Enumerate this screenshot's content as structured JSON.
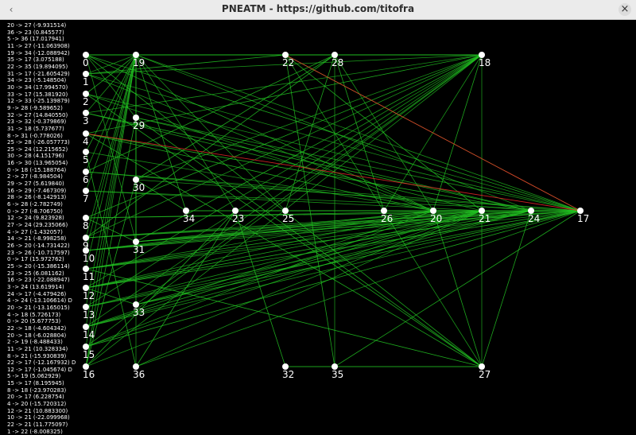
{
  "window": {
    "title": "PNEATM - https://github.com/titofra",
    "close_glyph": "×",
    "left_glyph": "‹"
  },
  "network": {
    "edge_color": "#22c322",
    "negative_edge_color": "#ff2a2a",
    "node_color": "#ffffff",
    "nodes": [
      {
        "id": "0",
        "label": "0"
      },
      {
        "id": "1",
        "label": "1"
      },
      {
        "id": "2",
        "label": "2"
      },
      {
        "id": "3",
        "label": "3"
      },
      {
        "id": "4",
        "label": "4"
      },
      {
        "id": "5",
        "label": "5"
      },
      {
        "id": "6",
        "label": "6"
      },
      {
        "id": "7",
        "label": "7"
      },
      {
        "id": "8",
        "label": "8"
      },
      {
        "id": "9",
        "label": "9"
      },
      {
        "id": "10",
        "label": "10"
      },
      {
        "id": "11",
        "label": "11"
      },
      {
        "id": "12",
        "label": "12"
      },
      {
        "id": "13",
        "label": "13"
      },
      {
        "id": "14",
        "label": "14"
      },
      {
        "id": "15",
        "label": "15"
      },
      {
        "id": "16",
        "label": "16"
      },
      {
        "id": "19",
        "label": "19"
      },
      {
        "id": "29",
        "label": "29"
      },
      {
        "id": "30",
        "label": "30"
      },
      {
        "id": "31",
        "label": "31"
      },
      {
        "id": "33",
        "label": "33"
      },
      {
        "id": "36",
        "label": "36"
      },
      {
        "id": "22",
        "label": "22"
      },
      {
        "id": "28",
        "label": "28"
      },
      {
        "id": "18",
        "label": "18"
      },
      {
        "id": "34",
        "label": "34"
      },
      {
        "id": "23",
        "label": "23"
      },
      {
        "id": "25",
        "label": "25"
      },
      {
        "id": "26",
        "label": "26"
      },
      {
        "id": "20",
        "label": "20"
      },
      {
        "id": "21",
        "label": "21"
      },
      {
        "id": "24",
        "label": "24"
      },
      {
        "id": "17",
        "label": "17"
      },
      {
        "id": "32",
        "label": "32"
      },
      {
        "id": "35",
        "label": "35"
      },
      {
        "id": "27",
        "label": "27"
      }
    ],
    "connections": [
      {
        "text": "20 -> 27  (-9.931514)",
        "from": "20",
        "to": "27",
        "weight": -9.931514
      },
      {
        "text": "36 -> 23  (0.845577)",
        "from": "36",
        "to": "23",
        "weight": 0.845577
      },
      {
        "text": "5 -> 36  (17.017941)",
        "from": "5",
        "to": "36",
        "weight": 17.017941
      },
      {
        "text": "11 -> 27  (-11.063908)",
        "from": "11",
        "to": "27",
        "weight": -11.063908
      },
      {
        "text": "19 -> 34  (-12.088942)",
        "from": "19",
        "to": "34",
        "weight": -12.088942
      },
      {
        "text": "35 -> 17  (3.075188)",
        "from": "35",
        "to": "17",
        "weight": 3.075188
      },
      {
        "text": "22 -> 35  (19.894095)",
        "from": "22",
        "to": "35",
        "weight": 19.894095
      },
      {
        "text": "31 -> 17  (-21.605429)",
        "from": "31",
        "to": "17",
        "weight": -21.605429
      },
      {
        "text": "34 -> 23  (-5.148504)",
        "from": "34",
        "to": "23",
        "weight": -5.148504
      },
      {
        "text": "30 -> 34  (17.994570)",
        "from": "30",
        "to": "34",
        "weight": 17.99457
      },
      {
        "text": "33 -> 17  (15.381920)",
        "from": "33",
        "to": "17",
        "weight": 15.38192
      },
      {
        "text": "12 -> 33  (-25.139879)",
        "from": "12",
        "to": "33",
        "weight": -25.139879
      },
      {
        "text": "9 -> 28  (-9.589652)",
        "from": "9",
        "to": "28",
        "weight": -9.589652
      },
      {
        "text": "32 -> 27  (14.840550)",
        "from": "32",
        "to": "27",
        "weight": 14.84055
      },
      {
        "text": "23 -> 32  (-0.379869)",
        "from": "23",
        "to": "32",
        "weight": -0.379869
      },
      {
        "text": "31 -> 18  (5.737677)",
        "from": "31",
        "to": "18",
        "weight": 5.737677
      },
      {
        "text": "8 -> 31  (-0.778026)",
        "from": "8",
        "to": "31",
        "weight": -0.778026
      },
      {
        "text": "25 -> 28  (-26.057773)",
        "from": "25",
        "to": "28",
        "weight": -26.057773
      },
      {
        "text": "25 -> 24  (12.215652)",
        "from": "25",
        "to": "24",
        "weight": 12.215652
      },
      {
        "text": "30 -> 28  (4.151796)",
        "from": "30",
        "to": "28",
        "weight": 4.151796
      },
      {
        "text": "16 -> 30  (13.965054)",
        "from": "16",
        "to": "30",
        "weight": 13.965054
      },
      {
        "text": "0 -> 18  (-15.188764)",
        "from": "0",
        "to": "18",
        "weight": -15.188764
      },
      {
        "text": "2 -> 27  (-8.984504)",
        "from": "2",
        "to": "27",
        "weight": -8.984504
      },
      {
        "text": "29 -> 27  (5.619840)",
        "from": "29",
        "to": "27",
        "weight": 5.61984
      },
      {
        "text": "16 -> 29  (-7.467309)",
        "from": "16",
        "to": "29",
        "weight": -7.467309
      },
      {
        "text": "28 -> 26  (-8.142913)",
        "from": "28",
        "to": "26",
        "weight": -8.142913
      },
      {
        "text": "6 -> 28  (-2.782749)",
        "from": "6",
        "to": "28",
        "weight": -2.782749
      },
      {
        "text": "0 -> 27  (-8.706750)",
        "from": "0",
        "to": "27",
        "weight": -8.70675
      },
      {
        "text": "12 -> 24  (9.823928)",
        "from": "12",
        "to": "24",
        "weight": 9.823928
      },
      {
        "text": "27 -> 24  (29.235066)",
        "from": "27",
        "to": "24",
        "weight": 29.235066
      },
      {
        "text": "4 -> 27  (-1.432057)",
        "from": "4",
        "to": "27",
        "weight": -1.432057
      },
      {
        "text": "14 -> 21  (-8.998258)",
        "from": "14",
        "to": "21",
        "weight": -8.998258
      },
      {
        "text": "26 -> 20  (-14.731422)",
        "from": "26",
        "to": "20",
        "weight": -14.731422
      },
      {
        "text": "23 -> 26  (-10.717597)",
        "from": "23",
        "to": "26",
        "weight": -10.717597
      },
      {
        "text": "0 -> 17  (15.972762)",
        "from": "0",
        "to": "17",
        "weight": 15.972762
      },
      {
        "text": "25 -> 20  (-15.386114)",
        "from": "25",
        "to": "20",
        "weight": -15.386114
      },
      {
        "text": "23 -> 25  (6.081162)",
        "from": "23",
        "to": "25",
        "weight": 6.081162
      },
      {
        "text": "16 -> 23  (-22.088947)",
        "from": "16",
        "to": "23",
        "weight": -22.088947
      },
      {
        "text": "3 -> 24  (13.619914)",
        "from": "3",
        "to": "24",
        "weight": 13.619914
      },
      {
        "text": "24 -> 17  (-4.479426)",
        "from": "24",
        "to": "17",
        "weight": -4.479426
      },
      {
        "text": "4 -> 24  (-13.106614) D",
        "from": "4",
        "to": "24",
        "weight": -13.106614
      },
      {
        "text": "20 -> 21  (-13.165015)",
        "from": "20",
        "to": "21",
        "weight": -13.165015
      },
      {
        "text": "4 -> 18  (5.726173)",
        "from": "4",
        "to": "18",
        "weight": 5.726173
      },
      {
        "text": "0 -> 20  (5.677753)",
        "from": "0",
        "to": "20",
        "weight": 5.677753
      },
      {
        "text": "22 -> 18  (-4.604342)",
        "from": "22",
        "to": "18",
        "weight": -4.604342
      },
      {
        "text": "20 -> 18  (-6.028804)",
        "from": "20",
        "to": "18",
        "weight": -6.028804
      },
      {
        "text": "2 -> 19  (-8.488433)",
        "from": "2",
        "to": "19",
        "weight": -8.488433
      },
      {
        "text": "11 -> 21  (10.328334)",
        "from": "11",
        "to": "21",
        "weight": 10.328334
      },
      {
        "text": "8 -> 21  (-15.930839)",
        "from": "8",
        "to": "21",
        "weight": -15.930839
      },
      {
        "text": "22 -> 17  (-12.167932) D",
        "from": "22",
        "to": "17",
        "weight": -12.167932
      },
      {
        "text": "12 -> 17  (-1.045674) D",
        "from": "12",
        "to": "17",
        "weight": -1.045674
      },
      {
        "text": "5 -> 19  (5.062929)",
        "from": "5",
        "to": "19",
        "weight": 5.062929
      },
      {
        "text": "15 -> 17  (8.195945)",
        "from": "15",
        "to": "17",
        "weight": 8.195945
      },
      {
        "text": "8 -> 18  (-23.970283)",
        "from": "8",
        "to": "18",
        "weight": -23.970283
      },
      {
        "text": "20 -> 17  (6.228754)",
        "from": "20",
        "to": "17",
        "weight": 6.228754
      },
      {
        "text": "4 -> 20  (-15.720312)",
        "from": "4",
        "to": "20",
        "weight": -15.720312
      },
      {
        "text": "12 -> 21  (10.883300)",
        "from": "12",
        "to": "21",
        "weight": 10.8833
      },
      {
        "text": "10 -> 21  (-22.099968)",
        "from": "10",
        "to": "21",
        "weight": -22.099968
      },
      {
        "text": "22 -> 21  (11.775097)",
        "from": "22",
        "to": "21",
        "weight": 11.775097
      },
      {
        "text": "1 -> 22  (-8.008325)",
        "from": "1",
        "to": "22",
        "weight": -8.008325
      }
    ],
    "extra_edges": [
      [
        "0",
        "19"
      ],
      [
        "0",
        "22"
      ],
      [
        "0",
        "28"
      ],
      [
        "22",
        "28"
      ],
      [
        "28",
        "18"
      ],
      [
        "19",
        "18"
      ],
      [
        "32",
        "35"
      ],
      [
        "35",
        "27"
      ],
      [
        "1",
        "19"
      ],
      [
        "3",
        "19"
      ],
      [
        "6",
        "19"
      ],
      [
        "7",
        "19"
      ],
      [
        "9",
        "19"
      ],
      [
        "10",
        "19"
      ],
      [
        "11",
        "19"
      ],
      [
        "13",
        "19"
      ],
      [
        "14",
        "19"
      ],
      [
        "15",
        "19"
      ],
      [
        "16",
        "19"
      ],
      [
        "0",
        "29"
      ],
      [
        "1",
        "18"
      ],
      [
        "3",
        "18"
      ],
      [
        "6",
        "17"
      ],
      [
        "7",
        "17"
      ],
      [
        "9",
        "17"
      ],
      [
        "10",
        "17"
      ],
      [
        "11",
        "17"
      ],
      [
        "13",
        "17"
      ],
      [
        "14",
        "17"
      ],
      [
        "1",
        "17"
      ],
      [
        "2",
        "17"
      ],
      [
        "8",
        "17"
      ],
      [
        "9",
        "24"
      ],
      [
        "10",
        "24"
      ],
      [
        "11",
        "24"
      ],
      [
        "13",
        "24"
      ],
      [
        "14",
        "24"
      ],
      [
        "6",
        "24"
      ],
      [
        "7",
        "21"
      ],
      [
        "9",
        "21"
      ],
      [
        "13",
        "21"
      ],
      [
        "15",
        "21"
      ],
      [
        "1",
        "20"
      ],
      [
        "2",
        "20"
      ],
      [
        "5",
        "20"
      ],
      [
        "10",
        "20"
      ],
      [
        "11",
        "20"
      ],
      [
        "13",
        "18"
      ],
      [
        "14",
        "18"
      ],
      [
        "15",
        "18"
      ],
      [
        "9",
        "18"
      ],
      [
        "3",
        "21"
      ],
      [
        "0",
        "31"
      ],
      [
        "19",
        "33"
      ],
      [
        "19",
        "36"
      ],
      [
        "33",
        "18"
      ],
      [
        "36",
        "21"
      ],
      [
        "31",
        "24"
      ],
      [
        "29",
        "17"
      ],
      [
        "30",
        "17"
      ],
      [
        "19",
        "31"
      ],
      [
        "28",
        "20"
      ],
      [
        "22",
        "27"
      ],
      [
        "28",
        "35"
      ],
      [
        "18",
        "26"
      ],
      [
        "18",
        "27"
      ],
      [
        "30",
        "18"
      ],
      [
        "33",
        "21"
      ],
      [
        "31",
        "20"
      ],
      [
        "12",
        "18"
      ],
      [
        "16",
        "18"
      ],
      [
        "16",
        "21"
      ],
      [
        "15",
        "20"
      ],
      [
        "14",
        "20"
      ],
      [
        "12",
        "20"
      ],
      [
        "34",
        "17"
      ],
      [
        "23",
        "17"
      ],
      [
        "25",
        "17"
      ],
      [
        "19",
        "17"
      ],
      [
        "19",
        "24"
      ],
      [
        "29",
        "24"
      ],
      [
        "33",
        "24"
      ],
      [
        "36",
        "17"
      ],
      [
        "31",
        "21"
      ],
      [
        "19",
        "23"
      ],
      [
        "19",
        "25"
      ]
    ],
    "negative_edges": [
      [
        "4",
        "17"
      ],
      [
        "22",
        "17"
      ]
    ]
  }
}
